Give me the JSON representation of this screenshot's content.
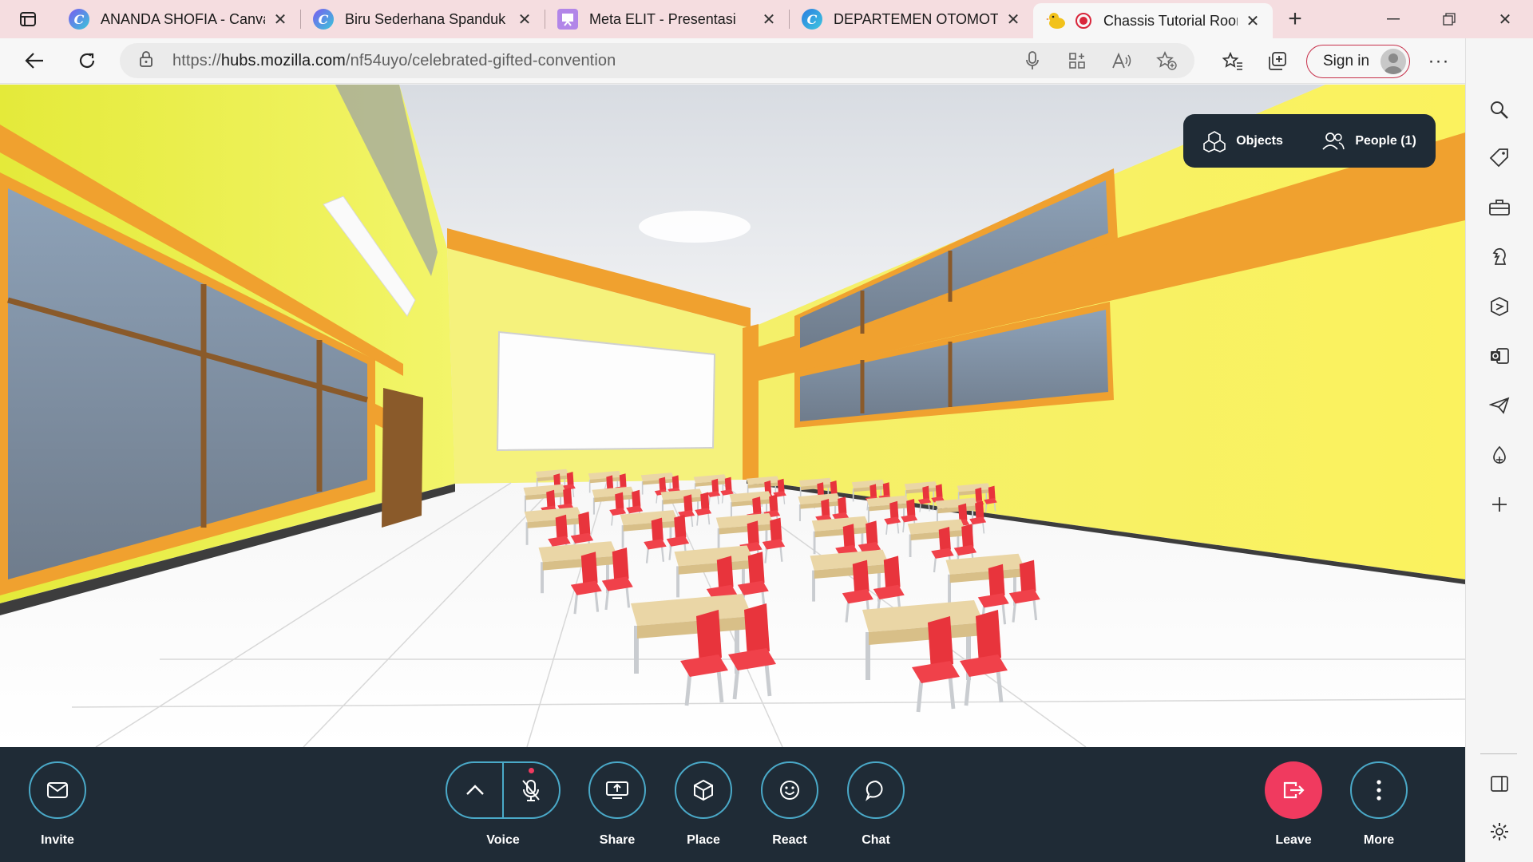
{
  "tabs": [
    {
      "title": "ANANDA SHOFIA - Canva",
      "icon": "canva-icon",
      "active": false
    },
    {
      "title": "Biru Sederhana Spanduk P",
      "icon": "canva-icon",
      "active": false
    },
    {
      "title": "Meta ELIT - Presentasi",
      "icon": "presentation-icon",
      "active": false
    },
    {
      "title": "DEPARTEMEN OTOMOTIF",
      "icon": "canva-icon",
      "active": false
    },
    {
      "title": "Chassis Tutorial Room",
      "icon": "hubs-icon",
      "active": true
    }
  ],
  "address": {
    "url_prefix": "https://",
    "url_host": "hubs.mozilla.com",
    "url_path": "/nf54uyo/celebrated-gifted-convention"
  },
  "toolbar": {
    "signin_label": "Sign in"
  },
  "scene_panel": {
    "objects_label": "Objects",
    "people_label": "People (1)"
  },
  "bottom": {
    "invite": "Invite",
    "voice": "Voice",
    "share": "Share",
    "place": "Place",
    "react": "React",
    "chat": "Chat",
    "leave": "Leave",
    "more": "More"
  },
  "colors": {
    "accent": "#4aa9c8",
    "leave": "#f03a5f",
    "panel": "#1f2b36",
    "tabbar": "#f5dde0"
  }
}
